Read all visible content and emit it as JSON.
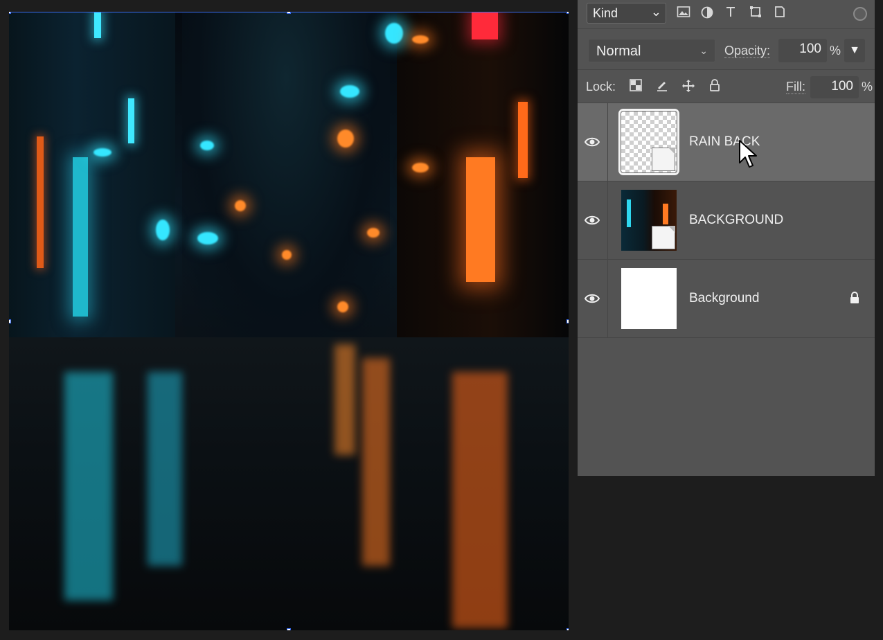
{
  "filter_bar": {
    "kind_label": "Kind",
    "filter_icons": [
      "pixel-layer-filter-icon",
      "adjustment-layer-filter-icon",
      "type-layer-filter-icon",
      "shape-layer-filter-icon",
      "smart-object-filter-icon"
    ]
  },
  "blend": {
    "mode": "Normal",
    "opacity_label": "Opacity:",
    "opacity_value": "100",
    "opacity_unit": "%"
  },
  "lock": {
    "label": "Lock:",
    "fill_label": "Fill:",
    "fill_value": "100",
    "fill_unit": "%"
  },
  "layers": [
    {
      "name": "RAIN BACK",
      "selected": true,
      "visible": true,
      "locked": false,
      "thumbnail": "transparent-smart-object"
    },
    {
      "name": "BACKGROUND",
      "selected": false,
      "visible": true,
      "locked": false,
      "thumbnail": "photo-smart-object"
    },
    {
      "name": "Background",
      "selected": false,
      "visible": true,
      "locked": true,
      "thumbnail": "white"
    }
  ],
  "colors": {
    "panel_bg": "#535353",
    "selected_row": "#6a6a6a",
    "neon_cyan": "#35e6ff",
    "neon_orange": "#ff8a2a"
  }
}
